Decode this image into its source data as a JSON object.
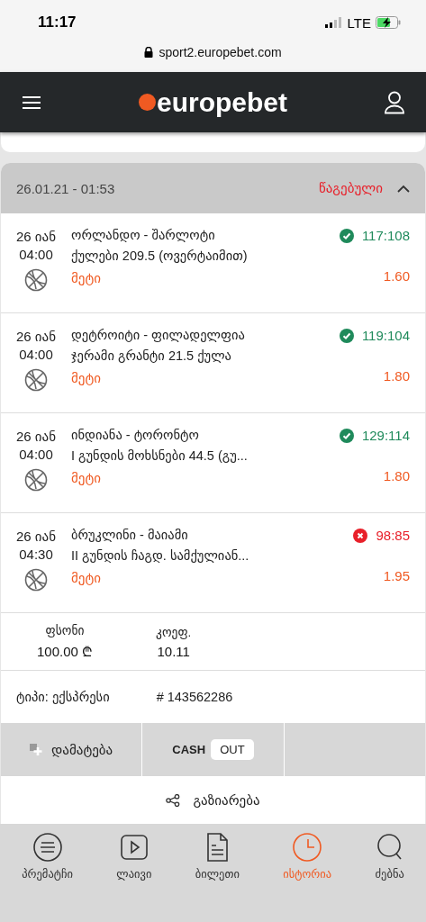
{
  "status_bar": {
    "time": "11:17",
    "network": "LTE"
  },
  "address_bar": {
    "url": "sport2.europebet.com"
  },
  "header": {
    "logo": "europebet"
  },
  "bet": {
    "date": "26.01.21 - 01:53",
    "status": "წაგებული",
    "expanded": true,
    "selections": [
      {
        "day": "26 იან",
        "time": "04:00",
        "teams": "ორლანდო - შარლოტი",
        "market": "ქულები 209.5 (ოვერტაიმით)",
        "pick": "მეტი",
        "won": true,
        "score": "117:108",
        "odds": "1.60"
      },
      {
        "day": "26 იან",
        "time": "04:00",
        "teams": "დეტროიტი - ფილადელფია",
        "market": "ჯერამი გრანტი 21.5 ქულა",
        "pick": "მეტი",
        "won": true,
        "score": "119:104",
        "odds": "1.80"
      },
      {
        "day": "26 იან",
        "time": "04:00",
        "teams": "ინდიანა - ტორონტო",
        "market": "I გუნდის მოხსნები 44.5 (გუ...",
        "pick": "მეტი",
        "won": true,
        "score": "129:114",
        "odds": "1.80"
      },
      {
        "day": "26 იან",
        "time": "04:30",
        "teams": "ბრუკლინი - მაიამი",
        "market": "II გუნდის ჩაგდ. სამქულიან...",
        "pick": "მეტი",
        "won": false,
        "score": "98:85",
        "odds": "1.95"
      }
    ],
    "stake_label": "ფსონი",
    "stake": "100.00 ₾",
    "odds_label": "კოეფ.",
    "odds": "10.11",
    "type": "ტიპი: ექსპრესი",
    "number": "# 143562286",
    "add_label": "დამატება",
    "cash_label": "CASH",
    "out_label": "OUT",
    "share_label": "გაზიარება"
  },
  "nav": [
    {
      "kind": "prematch",
      "label": "პრემატჩი",
      "selected": false
    },
    {
      "kind": "live",
      "label": "ლაივი",
      "selected": false
    },
    {
      "kind": "ticket",
      "label": "ბილეთი",
      "selected": false
    },
    {
      "kind": "history",
      "label": "ისტორია",
      "selected": true
    },
    {
      "kind": "search",
      "label": "ძებნა",
      "selected": false
    }
  ]
}
